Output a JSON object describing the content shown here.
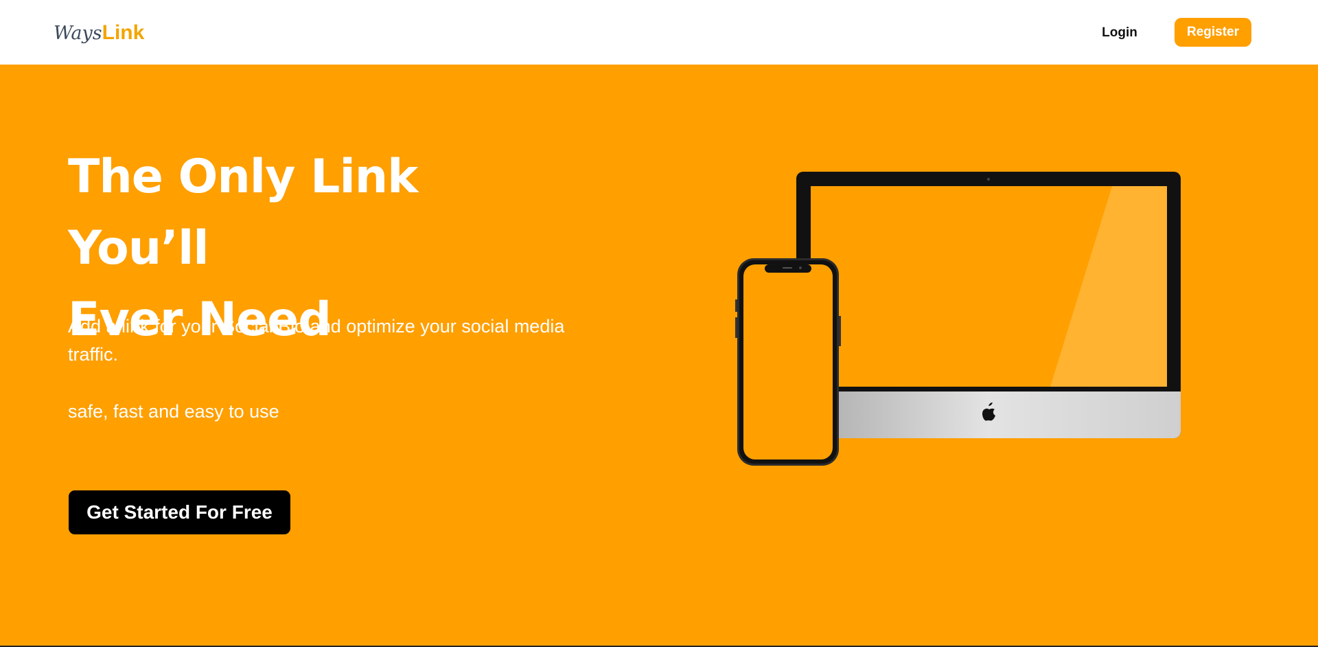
{
  "header": {
    "logo_part1": "Ways",
    "logo_part2": "Link",
    "login_label": "Login",
    "register_label": "Register"
  },
  "hero": {
    "headline_line1": "The Only Link You’ll",
    "headline_line2": "Ever Need",
    "subtext": "Add a link for your Social Bio and optimize your social media traffic.",
    "tagline": "safe, fast and easy to use",
    "cta_label": "Get Started For Free"
  },
  "colors": {
    "brand_orange": "#ff9f00",
    "header_bg": "#ffffff",
    "cta_bg": "#000000"
  },
  "icons": [
    "monitor-illustration",
    "phone-illustration",
    "apple-logo-icon"
  ]
}
